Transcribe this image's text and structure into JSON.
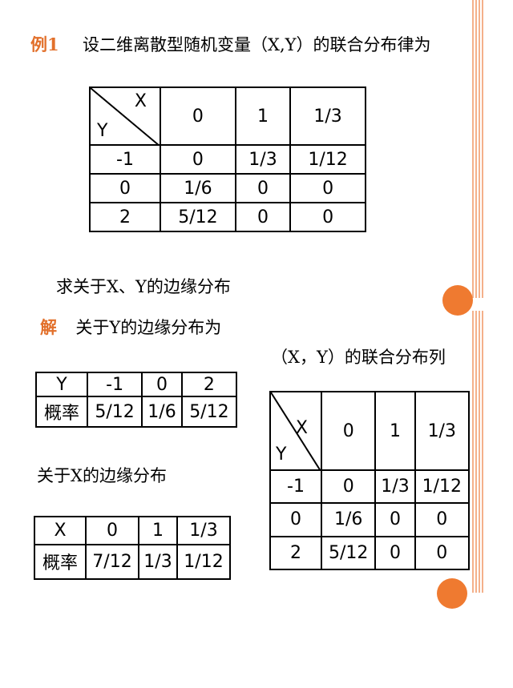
{
  "example": {
    "label": "例1",
    "title": "设二维离散型随机变量（X,Y）的联合分布律为"
  },
  "joint_table": {
    "x_label": "X",
    "y_label": "Y",
    "columns": [
      "0",
      "1",
      "1/3"
    ],
    "rows": [
      {
        "y": "-1",
        "cells": [
          "0",
          "1/3",
          "1/12"
        ]
      },
      {
        "y": "0",
        "cells": [
          "1/6",
          "0",
          "0"
        ]
      },
      {
        "y": "2",
        "cells": [
          "5/12",
          "0",
          "0"
        ]
      }
    ]
  },
  "question": "求关于X、Y的边缘分布",
  "solution": {
    "label": "解",
    "y_marginal_text": "关于Y的边缘分布为",
    "joint_caption": "（X，Y）的联合分布列",
    "x_marginal_text": "关于X的边缘分布"
  },
  "y_marginal": {
    "header": [
      "Y",
      "-1",
      "0",
      "2"
    ],
    "row": [
      "概率",
      "5/12",
      "1/6",
      "5/12"
    ]
  },
  "x_marginal": {
    "header": [
      "X",
      "0",
      "1",
      "1/3"
    ],
    "row": [
      "概率",
      "7/12",
      "1/3",
      "1/12"
    ]
  },
  "joint_table_2": {
    "x_label": "X",
    "y_label": "Y",
    "columns": [
      "0",
      "1",
      "1/3"
    ],
    "rows": [
      {
        "y": "-1",
        "cells": [
          "0",
          "1/3",
          "1/12"
        ]
      },
      {
        "y": "0",
        "cells": [
          "1/6",
          "0",
          "0"
        ]
      },
      {
        "y": "2",
        "cells": [
          "5/12",
          "0",
          "0"
        ]
      }
    ]
  },
  "colors": {
    "accent": "#e2702b",
    "decoration": "#ef7a30"
  }
}
